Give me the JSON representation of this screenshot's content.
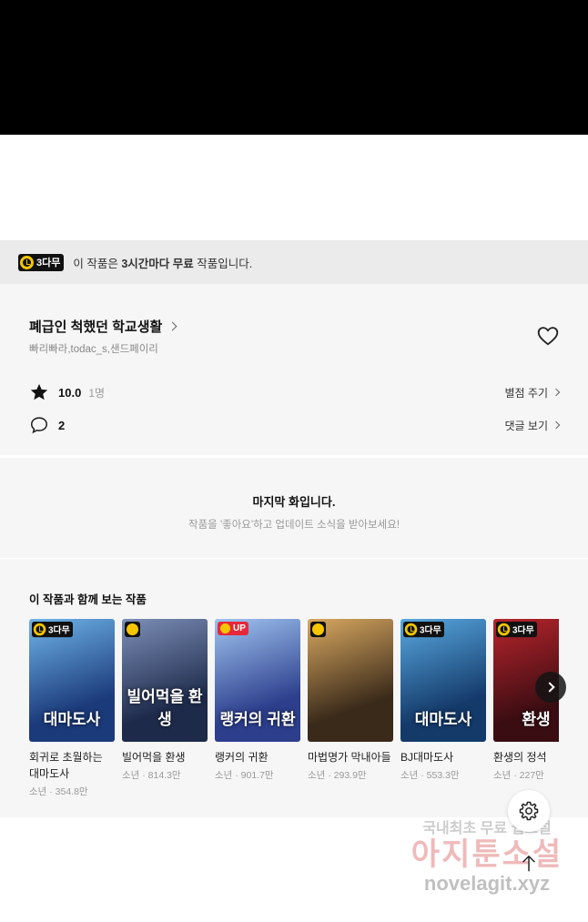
{
  "banner": {
    "badge": "3다무",
    "text_pre": "이 작품은 ",
    "text_bold": "3시간마다 무료",
    "text_post": " 작품입니다."
  },
  "work": {
    "title": "폐급인 척했던 학교생활",
    "authors": "빠리빠라,todac_s,샌드페이리",
    "rating": "10.0",
    "rating_count": "1명",
    "rate_action": "별점 주기",
    "comment_count": "2",
    "comment_action": "댓글 보기"
  },
  "last": {
    "title": "마지막 화입니다.",
    "subtitle": "작품을 '좋아요'하고 업데이트 소식을 받아보세요!"
  },
  "recommend": {
    "heading": "이 작품과 함께 보는 작품",
    "items": [
      {
        "name": "회귀로 초월하는 대마도사",
        "meta": "소년 · 354.8만",
        "badge": "3다무",
        "art": "대마도사",
        "c1": "#1b3a7a",
        "c2": "#6fb4e8"
      },
      {
        "name": "빌어먹을 환생",
        "meta": "소년 · 814.3만",
        "badge": "",
        "art": "빌어먹을 환생",
        "c1": "#1d2a4a",
        "c2": "#7d8fb8"
      },
      {
        "name": "랭커의 귀환",
        "meta": "소년 · 901.7만",
        "badge": "UP",
        "art": "랭커의 귀환",
        "c1": "#2c3e8c",
        "c2": "#a0c4f0"
      },
      {
        "name": "마법명가 막내아들",
        "meta": "소년 · 293.9만",
        "badge": "",
        "art": "",
        "c1": "#3a2a1a",
        "c2": "#d8a860"
      },
      {
        "name": "BJ대마도사",
        "meta": "소년 · 553.3만",
        "badge": "3다무",
        "art": "대마도사",
        "c1": "#143a6a",
        "c2": "#58a8e0"
      },
      {
        "name": "환생의 정석",
        "meta": "소년 · 227만",
        "badge": "3다무",
        "art": "환생",
        "c1": "#3a0d12",
        "c2": "#b8242c"
      }
    ]
  },
  "watermark": {
    "line1": "국내최초 무료 웹소설",
    "line2": "아지툰소설",
    "line3": "novelagit.xyz"
  },
  "colors": {
    "accent": "#f5c600",
    "up": "#e8273a",
    "section_bg": "#f6f6f6",
    "banner_bg": "#ebebeb"
  },
  "icons": [
    "clock-icon",
    "chevron-right-icon",
    "heart-icon",
    "star-icon",
    "comment-icon",
    "gear-icon",
    "arrow-up-icon"
  ]
}
